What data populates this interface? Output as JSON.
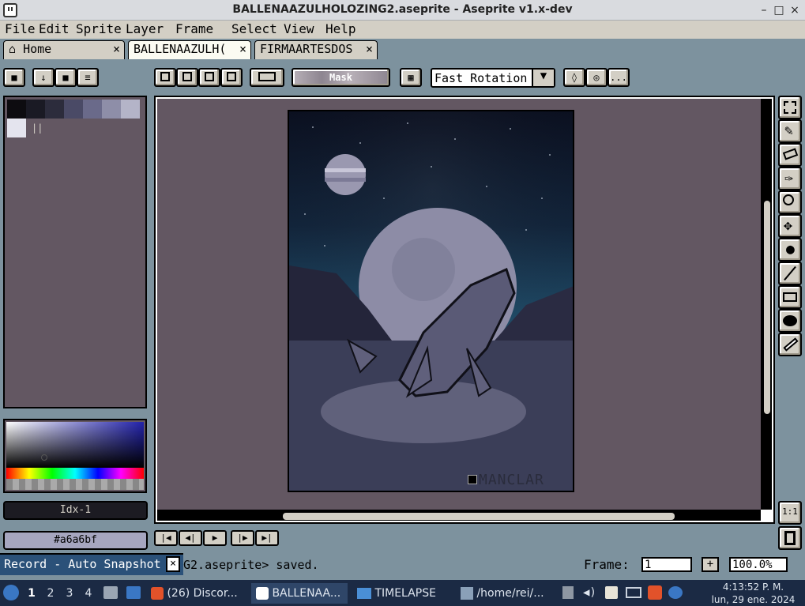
{
  "window": {
    "title": "BALLENAAZULHOLOZING2.aseprite - Aseprite v1.x-dev",
    "minimize": "–",
    "maximize": "□",
    "close": "×"
  },
  "menu": [
    "File",
    "Edit",
    "Sprite",
    "Layer",
    "Frame",
    "Select",
    "View",
    "Help"
  ],
  "tabs": [
    {
      "label": "Home",
      "close": "×"
    },
    {
      "label": "BALLENAAZULH(",
      "close": "×"
    },
    {
      "label": "FIRMAARTESDOS",
      "close": "×"
    }
  ],
  "toolbar": {
    "mask_label": "Mask",
    "rotation_algorithm": "Fast Rotation",
    "more": "..."
  },
  "palette": {
    "colors": [
      "#0d0c10",
      "#1a1a24",
      "#2c2c3c",
      "#4a4a66",
      "#6a6a8a",
      "#8e8ea8",
      "#b4b4c8",
      "#e4e4ee"
    ],
    "extra": "||"
  },
  "color": {
    "index_label": "Idx-1",
    "hex": "#a6a6bf",
    "fg": "#a6a6bf"
  },
  "zoom_buttons": {
    "one_to_one": "1:1"
  },
  "sprite": {
    "signature": "MANCLAR"
  },
  "frame": {
    "label": "Frame:",
    "value": "1",
    "plus": "+",
    "zoom": "100.0%"
  },
  "status": {
    "message": "G2.aseprite> saved."
  },
  "record": {
    "label": "Record - Auto Snapshot",
    "close": "×"
  },
  "taskbar": {
    "workspaces": [
      "1",
      "2",
      "3",
      "4"
    ],
    "tasks": [
      {
        "label": "(26) Discor..."
      },
      {
        "label": "BALLENAA..."
      },
      {
        "label": "TIMELAPSE"
      },
      {
        "label": "/home/rei/..."
      }
    ],
    "clock": {
      "time": "4:13:52 P. M.",
      "date": "lun, 29 ene. 2024"
    }
  }
}
